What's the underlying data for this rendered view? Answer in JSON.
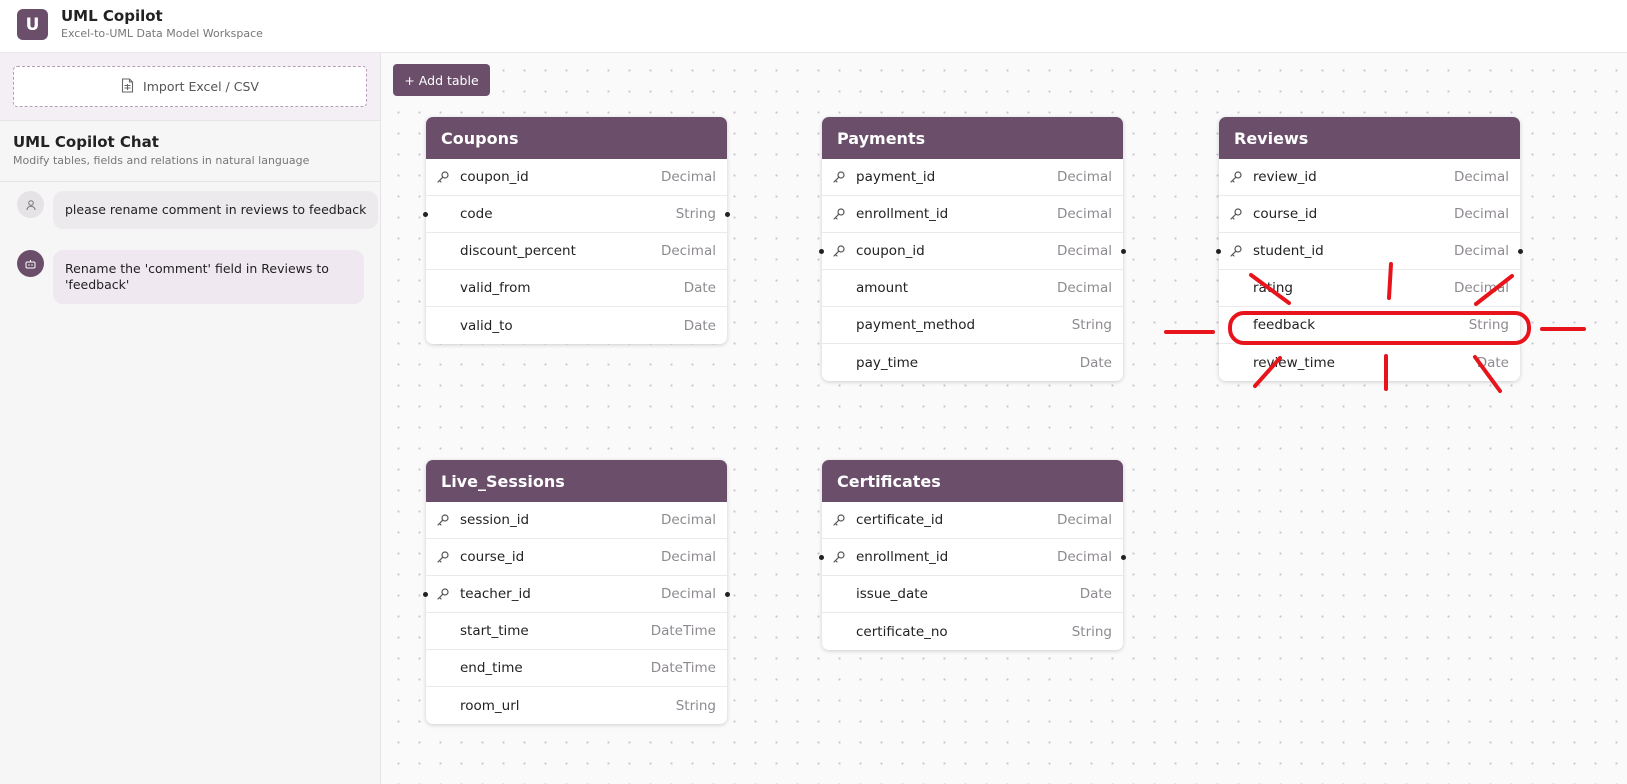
{
  "header": {
    "logo_letter": "U",
    "title": "UML Copilot",
    "subtitle": "Excel-to-UML Data Model Workspace"
  },
  "sidebar": {
    "import_label": "Import Excel / CSV",
    "chat_title": "UML Copilot Chat",
    "chat_subtitle": "Modify tables, fields and relations in natural language",
    "messages": [
      {
        "role": "user",
        "text": "please rename comment in reviews to feedback"
      },
      {
        "role": "assistant",
        "text": "Rename the 'comment' field in Reviews to 'feedback'"
      }
    ]
  },
  "toolbar": {
    "add_table_label": "+ Add table"
  },
  "tables": [
    {
      "name": "Coupons",
      "fields": [
        {
          "name": "coupon_id",
          "type": "Decimal",
          "key": true
        },
        {
          "name": "code",
          "type": "String",
          "key": false
        },
        {
          "name": "discount_percent",
          "type": "Decimal",
          "key": false
        },
        {
          "name": "valid_from",
          "type": "Date",
          "key": false
        },
        {
          "name": "valid_to",
          "type": "Date",
          "key": false
        }
      ]
    },
    {
      "name": "Payments",
      "fields": [
        {
          "name": "payment_id",
          "type": "Decimal",
          "key": true
        },
        {
          "name": "enrollment_id",
          "type": "Decimal",
          "key": true
        },
        {
          "name": "coupon_id",
          "type": "Decimal",
          "key": true
        },
        {
          "name": "amount",
          "type": "Decimal",
          "key": false
        },
        {
          "name": "payment_method",
          "type": "String",
          "key": false
        },
        {
          "name": "pay_time",
          "type": "Date",
          "key": false
        }
      ]
    },
    {
      "name": "Reviews",
      "fields": [
        {
          "name": "review_id",
          "type": "Decimal",
          "key": true
        },
        {
          "name": "course_id",
          "type": "Decimal",
          "key": true
        },
        {
          "name": "student_id",
          "type": "Decimal",
          "key": true
        },
        {
          "name": "rating",
          "type": "Decimal",
          "key": false
        },
        {
          "name": "feedback",
          "type": "String",
          "key": false
        },
        {
          "name": "review_time",
          "type": "Date",
          "key": false
        }
      ]
    },
    {
      "name": "Live_Sessions",
      "fields": [
        {
          "name": "session_id",
          "type": "Decimal",
          "key": true
        },
        {
          "name": "course_id",
          "type": "Decimal",
          "key": true
        },
        {
          "name": "teacher_id",
          "type": "Decimal",
          "key": true
        },
        {
          "name": "start_time",
          "type": "DateTime",
          "key": false
        },
        {
          "name": "end_time",
          "type": "DateTime",
          "key": false
        },
        {
          "name": "room_url",
          "type": "String",
          "key": false
        }
      ]
    },
    {
      "name": "Certificates",
      "fields": [
        {
          "name": "certificate_id",
          "type": "Decimal",
          "key": true
        },
        {
          "name": "enrollment_id",
          "type": "Decimal",
          "key": true
        },
        {
          "name": "issue_date",
          "type": "Date",
          "key": false
        },
        {
          "name": "certificate_no",
          "type": "String",
          "key": false
        }
      ]
    }
  ],
  "colors": {
    "brand": "#6a4e6a",
    "annotation": "#e8141c"
  }
}
